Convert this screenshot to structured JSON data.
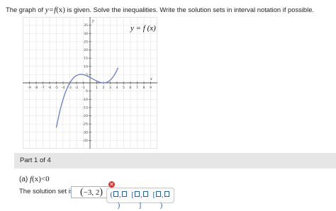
{
  "question": {
    "pre": "The graph of ",
    "equation": "y=f",
    "arg": "(x)",
    "post": " is given. Solve the inequalities. Write the solution sets in interval notation if possible."
  },
  "graph": {
    "curve_label": "y = f (x)",
    "x_axis_label": "x",
    "y_axis_label": "y",
    "x_ticks": [
      -9,
      -8,
      -7,
      -6,
      -5,
      -4,
      -3,
      -2,
      -1,
      1,
      2,
      3,
      4,
      5,
      6,
      7,
      8,
      9
    ],
    "y_ticks": [
      -35,
      -30,
      -25,
      -20,
      -15,
      -10,
      -5,
      5,
      10,
      15,
      20,
      25,
      30,
      35
    ],
    "x_range": [
      -10,
      10
    ],
    "y_range": [
      -40,
      40
    ],
    "grid": true,
    "function_note": "zeros at x = -3 and x = 2 (double root); local max near (-1, 5)",
    "line_color": "#6a7bc9"
  },
  "part": {
    "label": "Part 1 of 4"
  },
  "prompt": {
    "prefix": "(a) ",
    "func": "f",
    "arg": "(x)",
    "relation": "<0"
  },
  "answer": {
    "label": "The solution set is",
    "open": "(",
    "value": "−3, 2",
    "close": ")",
    "status": "incorrect",
    "error_icon": "✕",
    "period": "."
  },
  "palette": {
    "open_open": "(",
    "open_close": ")",
    "closed_open": "[",
    "closed_close": "]",
    "mixed_open": "[",
    "mixed_close": ")"
  },
  "colors": {
    "error": "#d9312b",
    "accent": "#2a5dab"
  }
}
